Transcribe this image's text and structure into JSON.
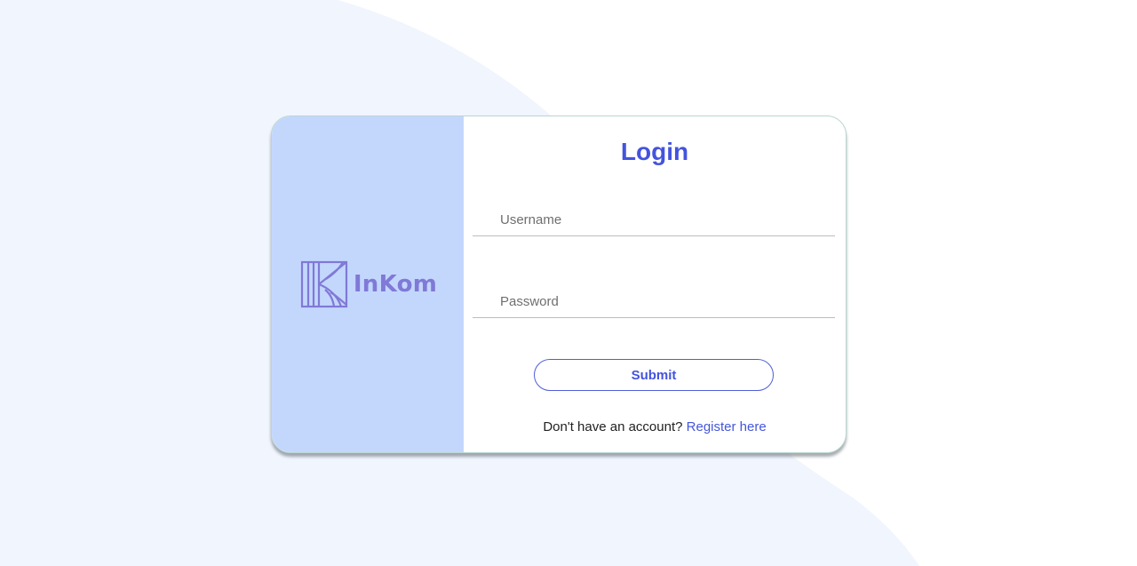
{
  "brand": {
    "name": "InKom",
    "logo_icon": "inkom-logo-icon",
    "panel_color": "#c3d7fd",
    "text_color": "#8079d6"
  },
  "login": {
    "title": "Login",
    "username_placeholder": "Username",
    "username_value": "",
    "password_placeholder": "Password",
    "password_value": "",
    "submit_label": "Submit",
    "register_prompt": "Don't have an account?",
    "register_link": "Register here"
  },
  "colors": {
    "accent": "#4454dd",
    "background_wave": "#f1f5fd"
  }
}
